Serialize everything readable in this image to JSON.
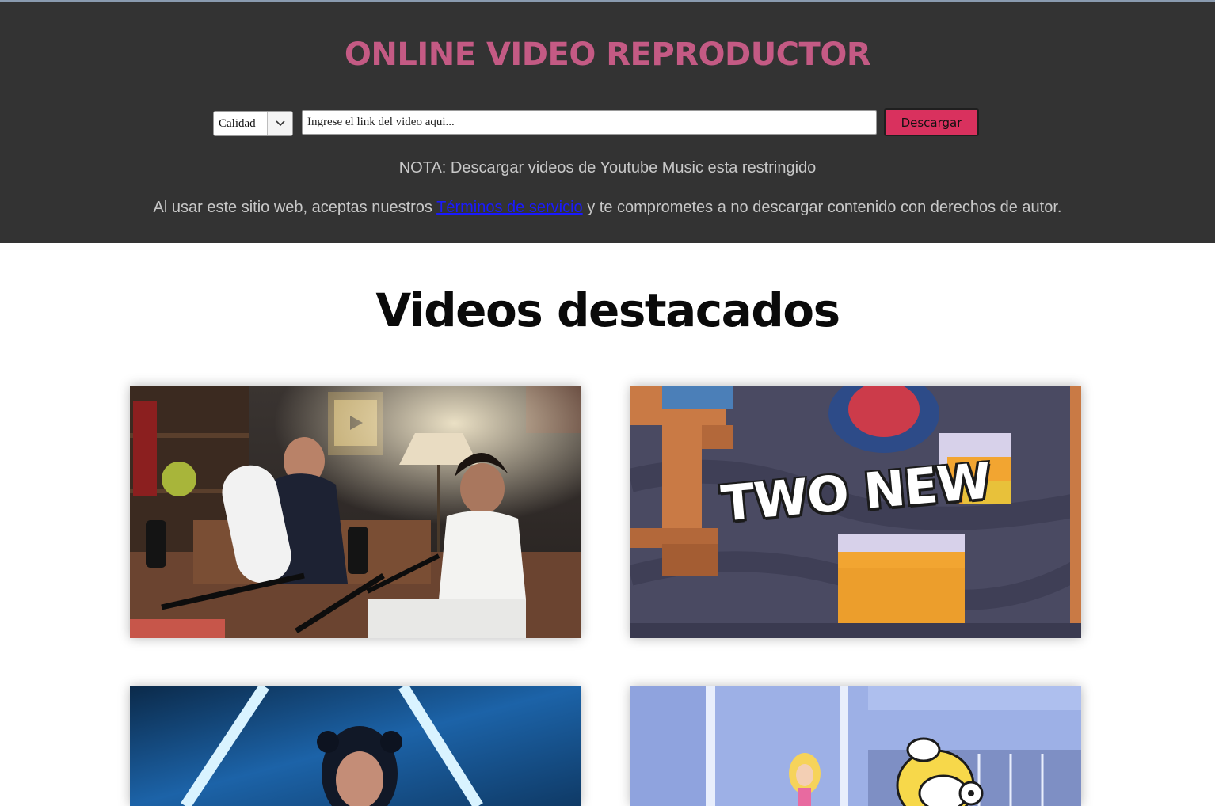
{
  "header": {
    "title": "ONLINE VIDEO REPRODUCTOR",
    "quality_select": {
      "selected": "Calidad"
    },
    "url_input": {
      "placeholder": "Ingrese el link del video aqui..."
    },
    "download_button": "Descargar",
    "note": "NOTA: Descargar videos de Youtube Music esta restringido",
    "terms": {
      "before": "Al usar este sitio web, aceptas nuestros ",
      "link": "Términos de servicio",
      "after": " y te comprometes a no descargar contenido con derechos de autor."
    }
  },
  "featured": {
    "title": "Videos destacados",
    "videos": [
      {
        "overlay_text": ""
      },
      {
        "overlay_text": "TWO NEW"
      },
      {
        "overlay_text": ""
      },
      {
        "overlay_text": ""
      }
    ]
  },
  "colors": {
    "header_bg": "#333333",
    "title": "#c45a84",
    "download_button": "#d9315e",
    "link": "#1a1aff"
  }
}
